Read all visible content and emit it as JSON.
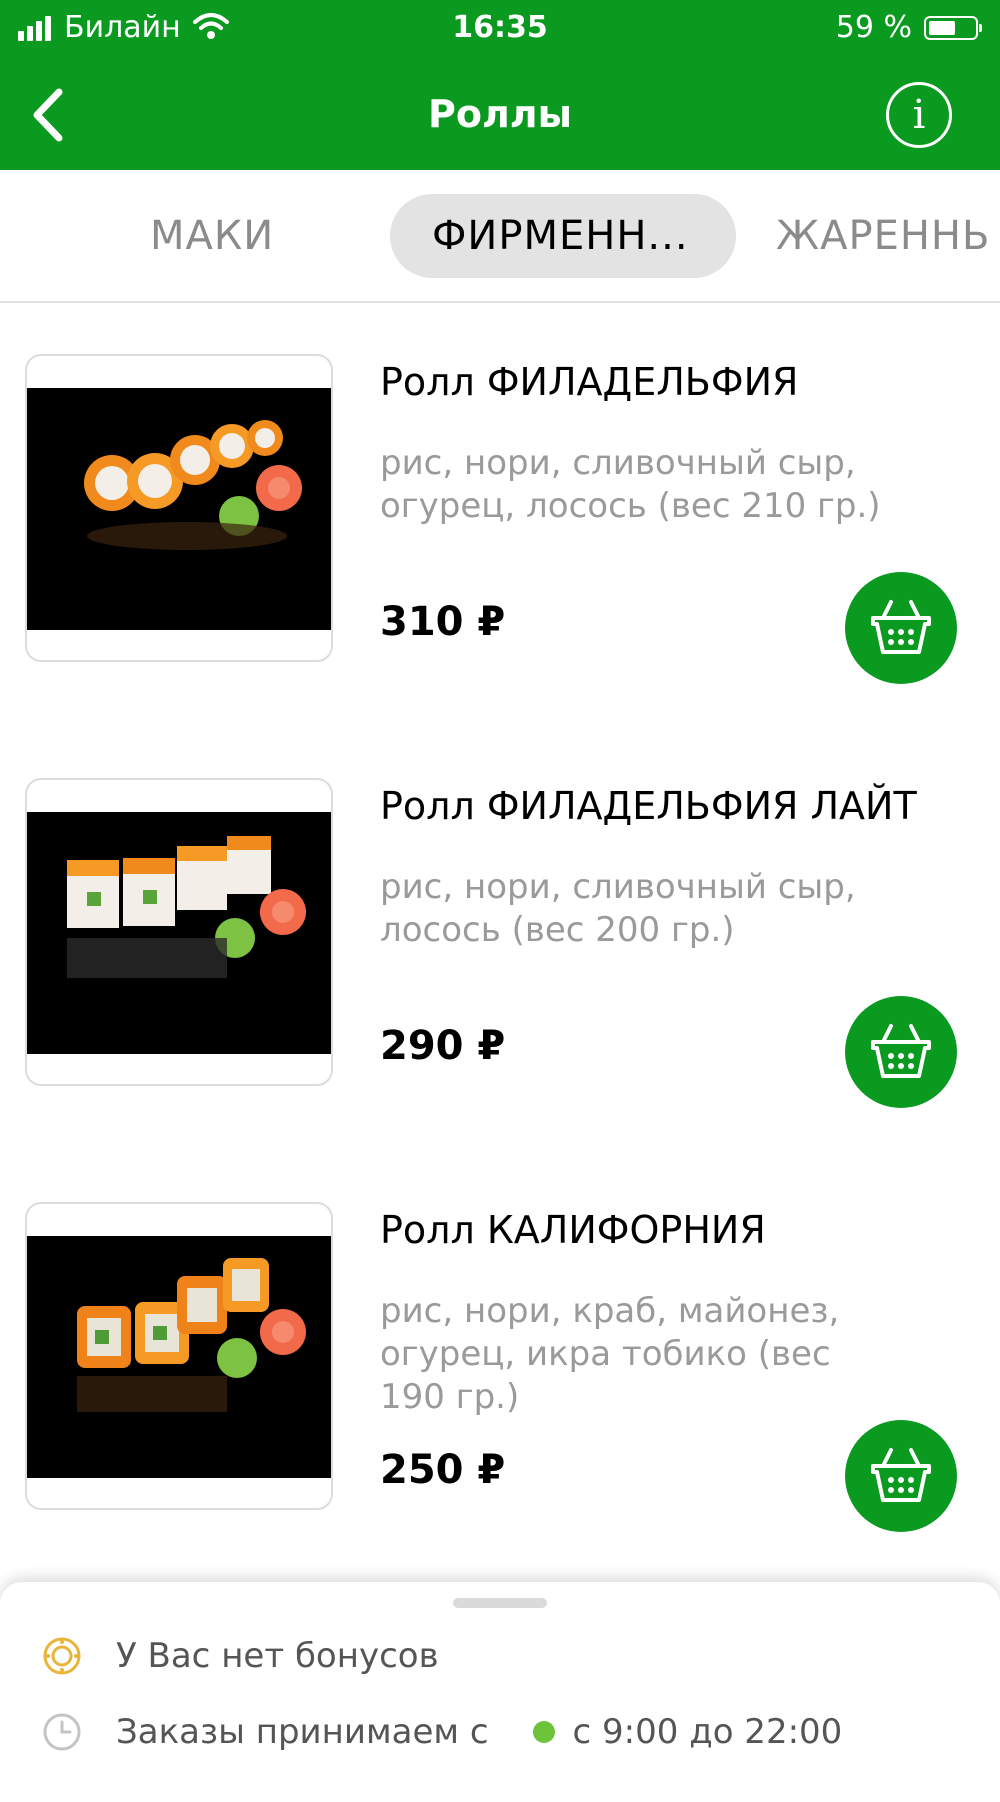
{
  "status_bar": {
    "carrier": "Билайн",
    "time": "16:35",
    "battery": "59 %",
    "battery_level": 0.59
  },
  "nav": {
    "title": "Роллы",
    "back_icon": "chevron-left-icon",
    "info_icon": "info-icon",
    "info_glyph": "i"
  },
  "tabs": [
    {
      "label": "МАКИ",
      "active": false
    },
    {
      "label": "ФИРМЕНН...",
      "active": true
    },
    {
      "label": "ЖАРЕННЬ",
      "active": false
    }
  ],
  "products": [
    {
      "name": "Ролл ФИЛАДЕЛЬФИЯ",
      "description": "рис, нори, сливочный сыр, огурец, лосось (вес 210 гр.)",
      "price": "310 ₽"
    },
    {
      "name": "Ролл ФИЛАДЕЛЬФИЯ ЛАЙТ",
      "description": "рис, нори, сливочный сыр, лосось (вес 200 гр.)",
      "price": "290 ₽"
    },
    {
      "name": "Ролл КАЛИФОРНИЯ",
      "description": "рис, нори, краб, майонез, огурец, икра тобико (вес 190 гр.)",
      "price": "250 ₽"
    }
  ],
  "bottom_sheet": {
    "bonus_text": "У Вас нет бонусов",
    "orders_text": "Заказы принимаем с",
    "hours": "с 9:00 до 22:00",
    "bonus_icon": "bonus-coin-icon",
    "clock_icon": "clock-icon",
    "status_color": "#6fc33b"
  },
  "colors": {
    "brand": "#0a9a1f",
    "muted_text": "#9a9a9a",
    "tab_active_bg": "#e3e3e3"
  }
}
